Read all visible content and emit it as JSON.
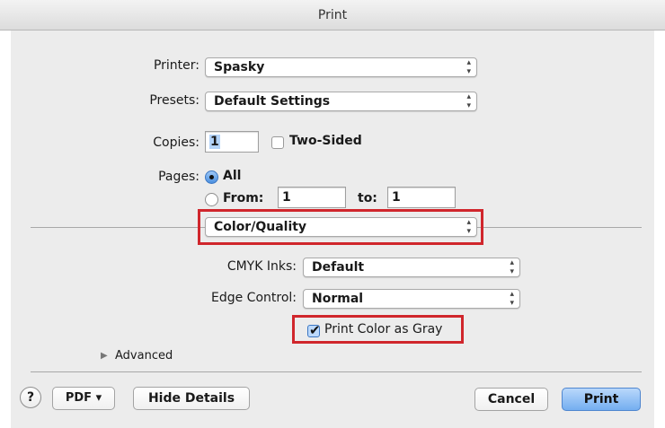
{
  "window": {
    "title": "Print"
  },
  "printer": {
    "label": "Printer:",
    "value": "Spasky"
  },
  "presets": {
    "label": "Presets:",
    "value": "Default Settings"
  },
  "copies": {
    "label": "Copies:",
    "value": "1",
    "two_sided_label": "Two-Sided",
    "two_sided_checked": false
  },
  "pages": {
    "label": "Pages:",
    "all_label": "All",
    "from_label": "From:",
    "from_value": "1",
    "to_label": "to:",
    "to_value": "1"
  },
  "panel_menu": {
    "value": "Color/Quality"
  },
  "cmyk_inks": {
    "label": "CMYK Inks:",
    "value": "Default"
  },
  "edge_control": {
    "label": "Edge Control:",
    "value": "Normal"
  },
  "print_color_as_gray": {
    "label": "Print Color as Gray",
    "checked": true
  },
  "advanced": {
    "label": "Advanced"
  },
  "footer": {
    "help_label": "?",
    "pdf_label": "PDF ▾",
    "hide_details_label": "Hide Details",
    "cancel_label": "Cancel",
    "print_label": "Print"
  },
  "colors": {
    "highlight": "#d0262c",
    "default_button": "#74aef0"
  }
}
